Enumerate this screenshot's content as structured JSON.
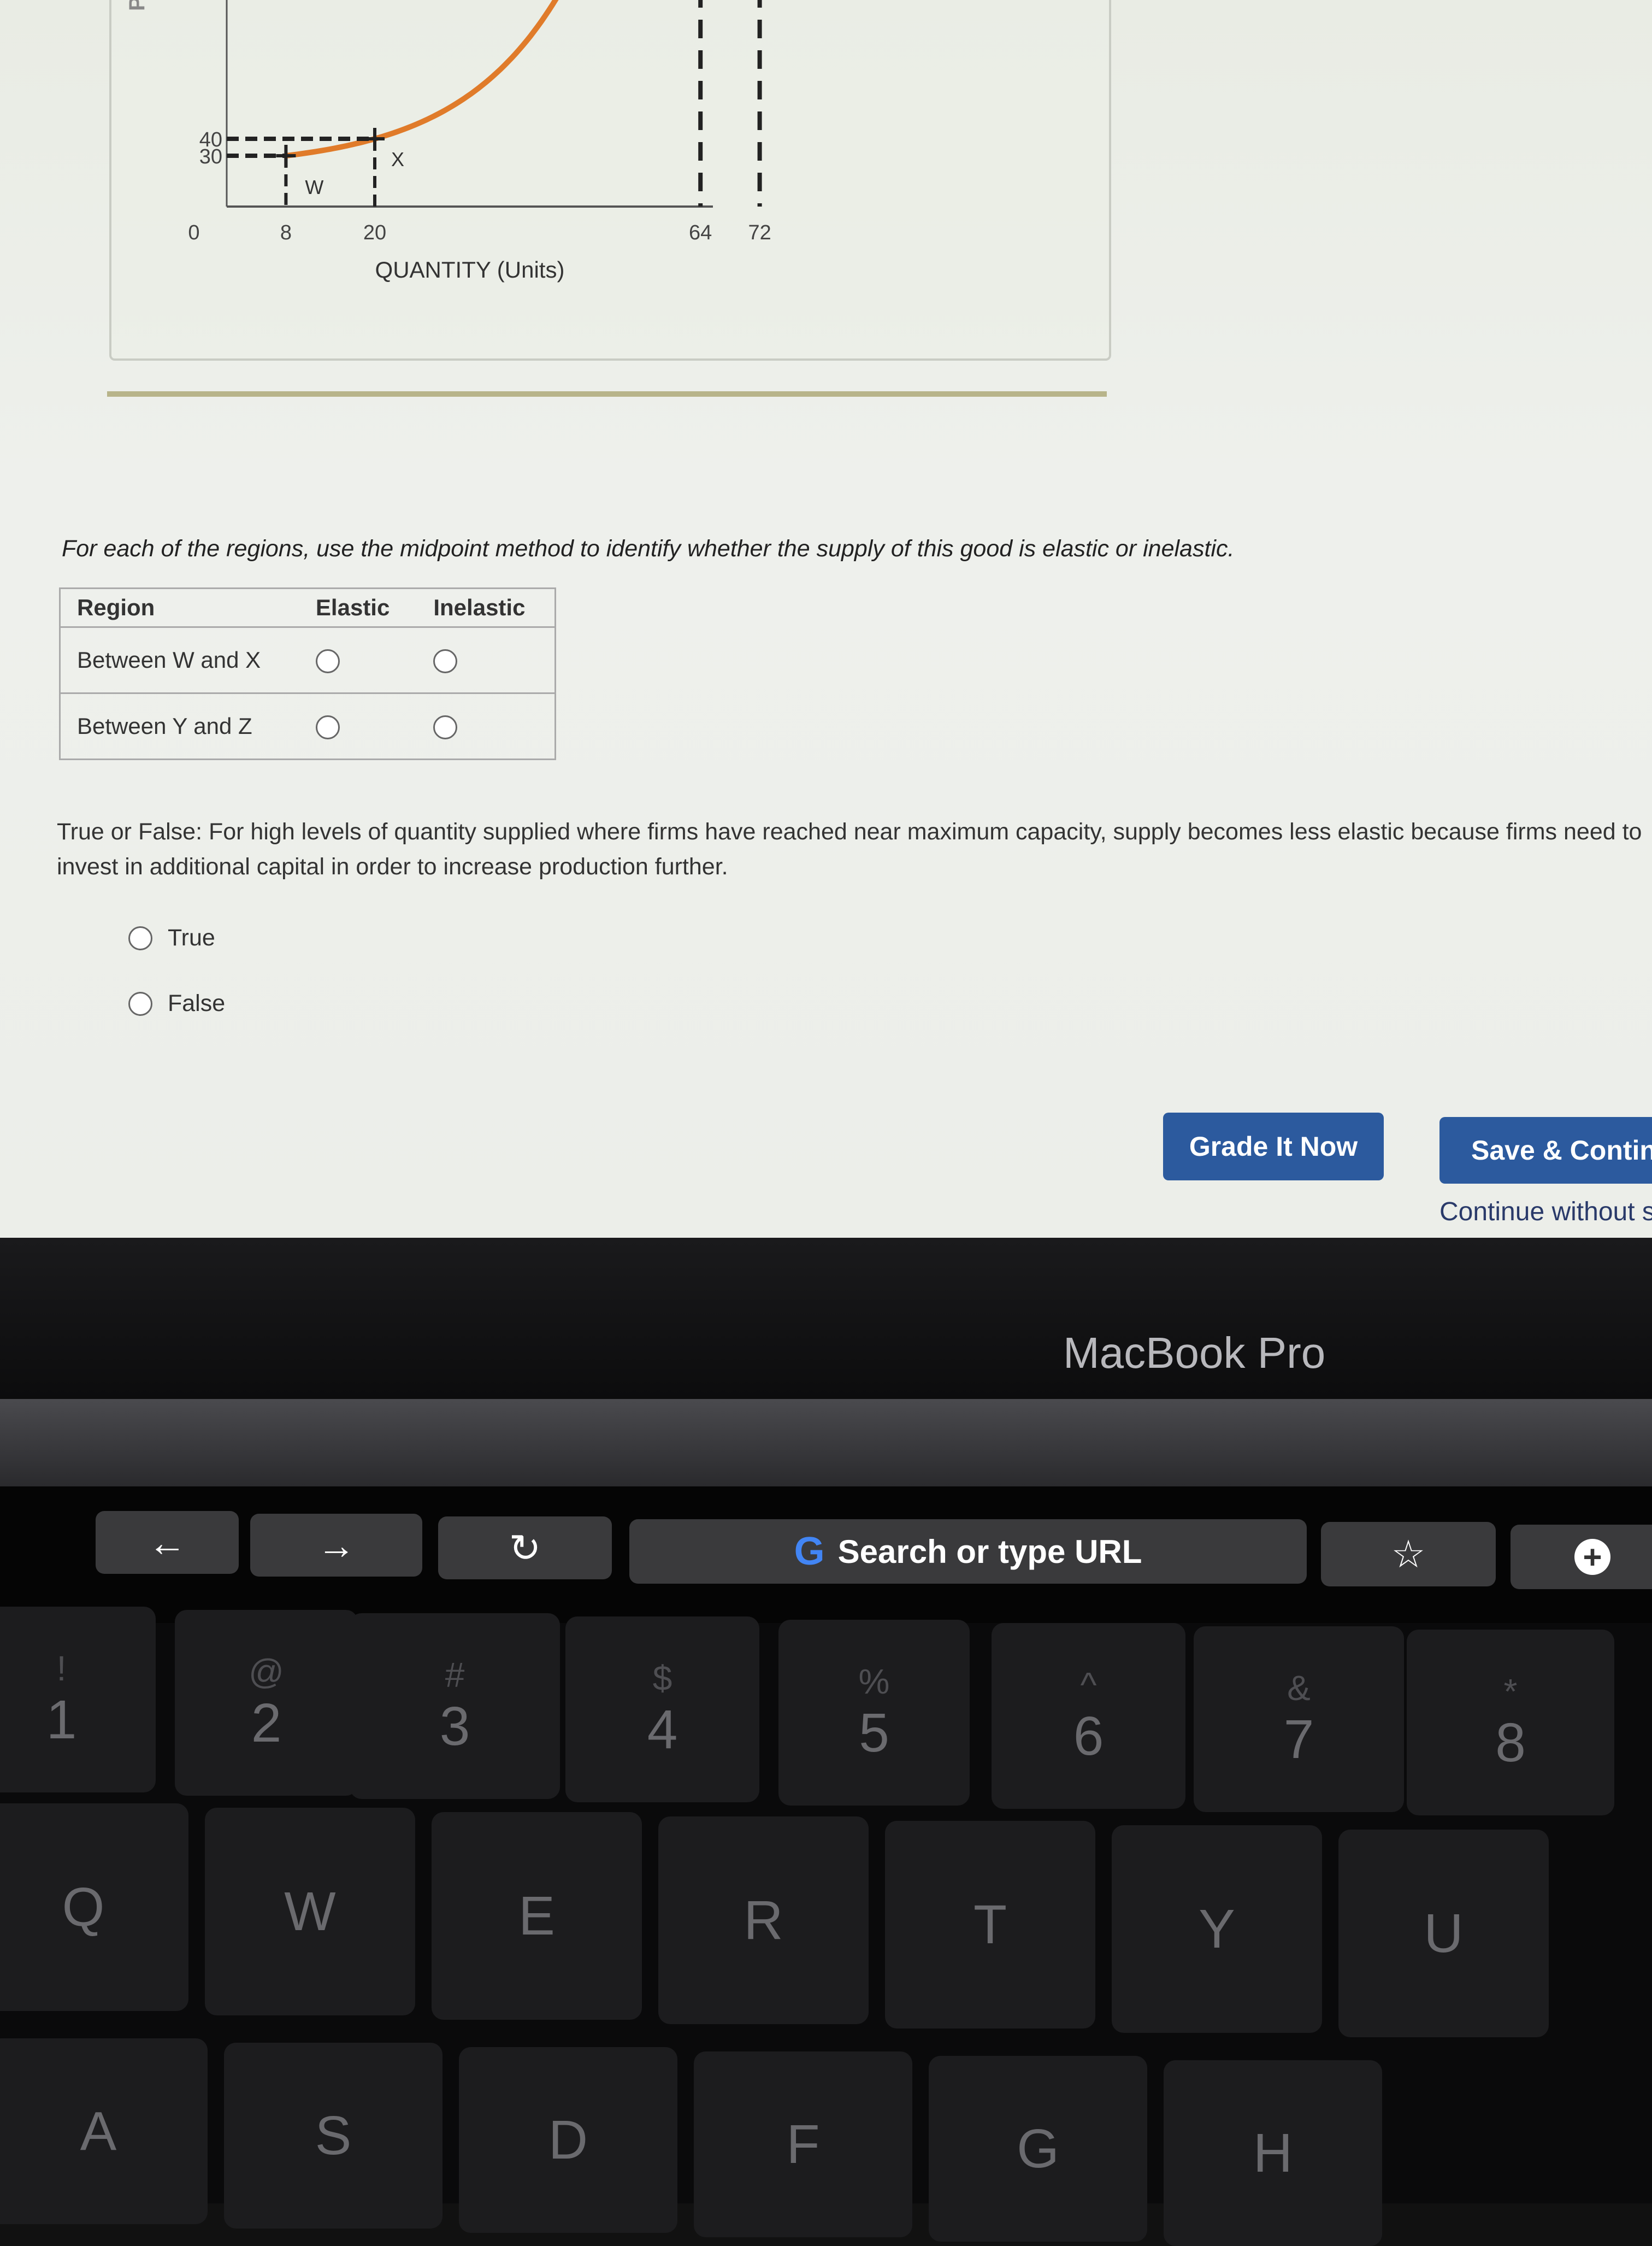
{
  "chart_data": {
    "type": "line",
    "xlabel": "QUANTITY (Units)",
    "ylabel_partial": "PRI",
    "x_ticks": [
      "0",
      "8",
      "20",
      "64",
      "72"
    ],
    "y_ticks": [
      "30",
      "40"
    ],
    "points": [
      {
        "label": "W",
        "x": 8,
        "y": 30
      },
      {
        "label": "X",
        "x": 20,
        "y": 40
      }
    ],
    "dashed_verticals": [
      64,
      72
    ],
    "curve_color": "#e07b2a"
  },
  "question": {
    "instruction": "For each of the regions, use the midpoint method to identify whether the supply of this good is elastic or inelastic.",
    "table": {
      "headers": [
        "Region",
        "Elastic",
        "Inelastic"
      ],
      "rows": [
        "Between W and X",
        "Between Y and Z"
      ]
    },
    "tf_prompt": "True or False: For high levels of quantity supplied where firms have reached near maximum capacity, supply becomes less elastic because firms need to invest in additional capital in order to increase production further.",
    "options": [
      "True",
      "False"
    ]
  },
  "actions": {
    "grade": "Grade It Now",
    "save": "Save & Continue",
    "continue_link": "Continue without saving"
  },
  "laptop": {
    "brand": "MacBook Pro",
    "touchbar": {
      "back": "←",
      "forward": "→",
      "reload": "↻",
      "search_placeholder": "Search or type URL",
      "bookmark": "☆",
      "new_tab": "+"
    },
    "row1": [
      [
        "!",
        "1"
      ],
      [
        "@",
        "2"
      ],
      [
        "#",
        "3"
      ],
      [
        "$",
        "4"
      ],
      [
        "%",
        "5"
      ],
      [
        "^",
        "6"
      ],
      [
        "&",
        "7"
      ],
      [
        "*",
        "8"
      ]
    ],
    "row2": [
      "Q",
      "W",
      "E",
      "R",
      "T",
      "Y",
      "U"
    ],
    "row3": [
      "A",
      "S",
      "D",
      "F",
      "G",
      "H"
    ]
  },
  "colors": {
    "button": "#2c5a9e",
    "curve": "#e07b2a"
  }
}
